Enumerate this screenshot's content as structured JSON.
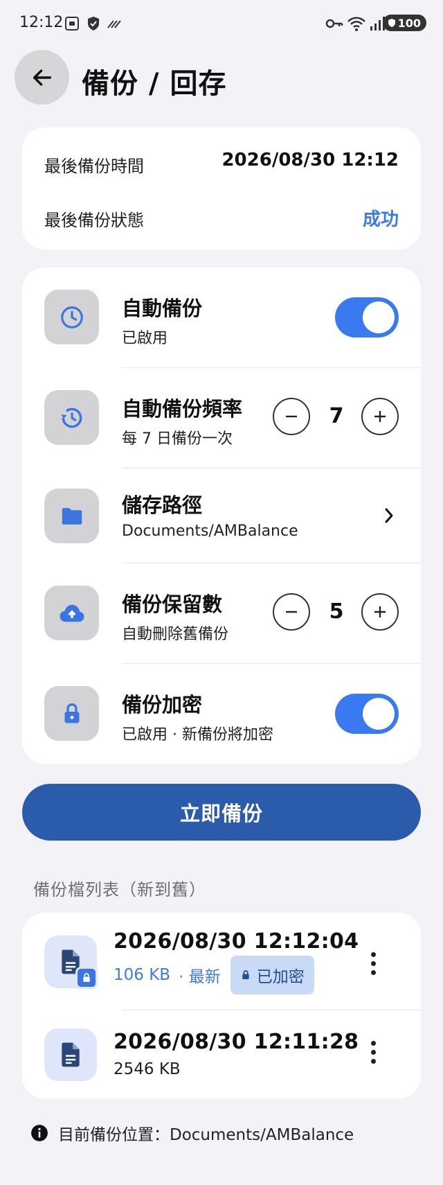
{
  "status_bar": {
    "time": "12:12",
    "battery": "100"
  },
  "header": {
    "title": "備份 / 回存"
  },
  "backup_info": {
    "last_time_label": "最後備份時間",
    "last_time_value": "2026/08/30 12:12",
    "last_status_label": "最後備份狀態",
    "last_status_value": "成功"
  },
  "settings": {
    "auto_backup": {
      "title": "自動備份",
      "subtitle": "已啟用",
      "enabled": true
    },
    "frequency": {
      "title": "自動備份頻率",
      "subtitle": "每 7 日備份一次",
      "value": "7"
    },
    "path": {
      "title": "儲存路徑",
      "subtitle": "Documents/AMBalance"
    },
    "retention": {
      "title": "備份保留數",
      "subtitle": "自動刪除舊備份",
      "value": "5"
    },
    "encryption": {
      "title": "備份加密",
      "subtitle": "已啟用 · 新備份將加密",
      "enabled": true
    }
  },
  "backup_now_label": "立即備份",
  "list_section_label": "備份檔列表（新到舊）",
  "backups": [
    {
      "name": "2026/08/30 12:12:04",
      "size": "106 KB",
      "tag": "· 最新",
      "encrypted_label": "已加密"
    },
    {
      "name": "2026/08/30 12:11:28",
      "size": "2546 KB"
    }
  ],
  "footer_info": "目前備份位置：Documents/AMBalance",
  "colors": {
    "accent": "#3a7af0",
    "primary_button": "#2b5cab",
    "success": "#3d7be0",
    "background": "#f2f2f7"
  },
  "icons": [
    "back-arrow-icon",
    "clock-icon",
    "history-icon",
    "folder-icon",
    "cloud-upload-icon",
    "lock-icon",
    "document-icon",
    "more-vert-icon",
    "info-icon"
  ]
}
